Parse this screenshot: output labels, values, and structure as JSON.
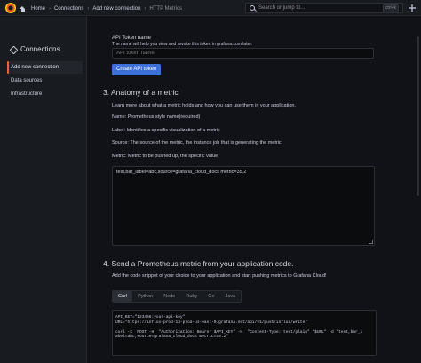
{
  "topbar": {
    "breadcrumbs": [
      "Home",
      "Connections",
      "Add new connection",
      "HTTP Metrics"
    ],
    "search_placeholder": "Search or jump to...",
    "search_shortcut": "ctrl+k"
  },
  "sidebar": {
    "title": "Connections",
    "items": [
      {
        "label": "Add new connection",
        "active": true
      },
      {
        "label": "Data sources",
        "active": false
      },
      {
        "label": "Infrastructure",
        "active": false
      }
    ]
  },
  "token": {
    "label": "API Token name",
    "description": "The name will help you view and revoke this token in grafana.com later.",
    "placeholder": "API token name",
    "button": "Create API token"
  },
  "section3": {
    "title": "3. Anatomy of a metric",
    "intro": "Learn more about what a metric holds and how you can use them in your application.",
    "name_line": "Name: Prometheus style name(required)",
    "label_line": "Label: Identifies a specific visualization of a metric",
    "source_line": "Source: The source of the metric, the instance job that is generating the metric",
    "metric_line": "Metric: Metric to be pushed up, the specific value",
    "textarea_value": "test,bar_label=abc,source=grafana_cloud_docs metric=35.2"
  },
  "section4": {
    "title": "4. Send a Prometheus metric from your application code.",
    "intro": "Add the code snippet of your choice to your application and start pushing metrics to Grafana Cloud!",
    "tabs": [
      "Curl",
      "Python",
      "Node",
      "Ruby",
      "Go",
      "Java"
    ],
    "active_tab": "Curl",
    "code": "API_KEY=\"123456:your-api-key\"\nURL=\"https://influx-prod-13-prod-us-east-0.grafana.net/api/v1/push/influx/write\"\n\ncurl -X  POST -H  \"Authorization: Bearer $API_KEY\" -H  \"Content-Type: text/plain\" \"$URL\" -d \"test,bar_l\nabel=abc,source=grafana_cloud_docs metric=35.2\""
  },
  "colors": {
    "accent": "#3d71d9",
    "active_indicator": "#f55f3e",
    "background": "#111217"
  }
}
